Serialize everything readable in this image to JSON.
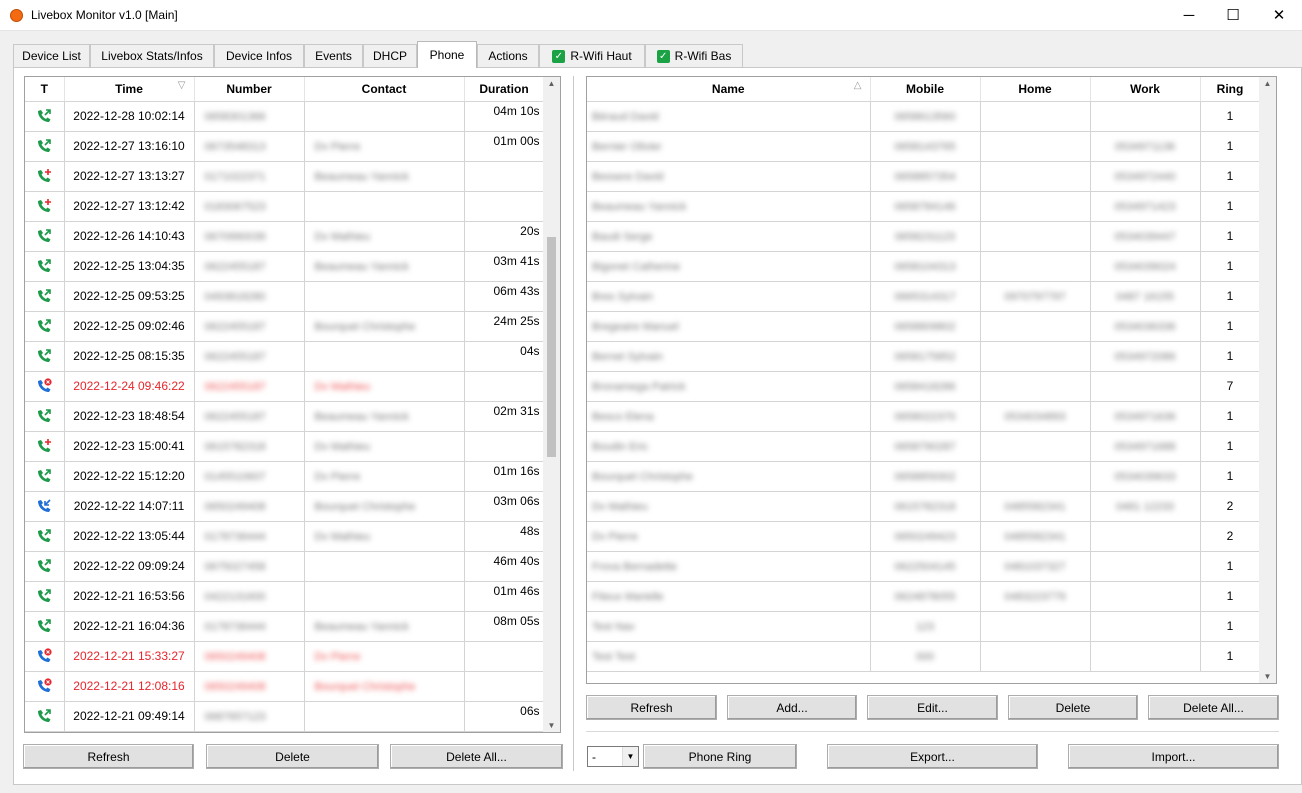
{
  "window": {
    "title": "Livebox Monitor v1.0 [Main]",
    "minimize_glyph": "─",
    "maximize_glyph": "☐",
    "close_glyph": "✕"
  },
  "tabs": [
    {
      "label": "Device List"
    },
    {
      "label": "Livebox Stats/Infos"
    },
    {
      "label": "Device Infos"
    },
    {
      "label": "Events"
    },
    {
      "label": "DHCP"
    },
    {
      "label": "Phone",
      "active": true
    },
    {
      "label": "Actions"
    },
    {
      "label": "R-Wifi Haut",
      "checked": true
    },
    {
      "label": "R-Wifi Bas",
      "checked": true
    }
  ],
  "calls": {
    "headers": {
      "type": "T",
      "time": "Time",
      "number": "Number",
      "contact": "Contact",
      "duration": "Duration"
    },
    "rows": [
      {
        "type": "outgoing",
        "time": "2022-12-28 10:02:14",
        "number": "0658301366",
        "contact": "",
        "duration": "04m 10s"
      },
      {
        "type": "outgoing",
        "time": "2022-12-27 13:16:10",
        "number": "0673548313",
        "contact": "Dv Pierre",
        "duration": "01m 00s"
      },
      {
        "type": "failed",
        "time": "2022-12-27 13:13:27",
        "number": "0171022371",
        "contact": "Beaumeau Yannick",
        "duration": ""
      },
      {
        "type": "failed",
        "time": "2022-12-27 13:12:42",
        "number": "0183067523",
        "contact": "",
        "duration": ""
      },
      {
        "type": "outgoing",
        "time": "2022-12-26 14:10:43",
        "number": "0670990039",
        "contact": "Dv Mathieu",
        "duration": "20s"
      },
      {
        "type": "outgoing",
        "time": "2022-12-25 13:04:35",
        "number": "0622455187",
        "contact": "Beaumeau Yannick",
        "duration": "03m 41s"
      },
      {
        "type": "outgoing",
        "time": "2022-12-25 09:53:25",
        "number": "0493818280",
        "contact": "",
        "duration": "06m 43s"
      },
      {
        "type": "outgoing",
        "time": "2022-12-25 09:02:46",
        "number": "0622455187",
        "contact": "Bourquet Christophe",
        "duration": "24m 25s"
      },
      {
        "type": "outgoing",
        "time": "2022-12-25 08:15:35",
        "number": "0622455187",
        "contact": "",
        "duration": "04s"
      },
      {
        "type": "missed",
        "time": "2022-12-24 09:46:22",
        "number": "0622455187",
        "contact": "Dv Mathieu",
        "duration": ""
      },
      {
        "type": "outgoing",
        "time": "2022-12-23 18:48:54",
        "number": "0622455187",
        "contact": "Beaumeau Yannick",
        "duration": "02m 31s"
      },
      {
        "type": "failed",
        "time": "2022-12-23 15:00:41",
        "number": "0615782318",
        "contact": "Dv Mathieu",
        "duration": ""
      },
      {
        "type": "outgoing",
        "time": "2022-12-22 15:12:20",
        "number": "0145510607",
        "contact": "Dv Pierre",
        "duration": "01m 16s"
      },
      {
        "type": "incoming",
        "time": "2022-12-22 14:07:11",
        "number": "0650249408",
        "contact": "Bourquet Christophe",
        "duration": "03m 06s"
      },
      {
        "type": "outgoing",
        "time": "2022-12-22 13:05:44",
        "number": "0178736444",
        "contact": "Dv Mathieu",
        "duration": "48s"
      },
      {
        "type": "outgoing",
        "time": "2022-12-22 09:09:24",
        "number": "0675027458",
        "contact": "",
        "duration": "46m 40s"
      },
      {
        "type": "outgoing",
        "time": "2022-12-21 16:53:56",
        "number": "0422131600",
        "contact": "",
        "duration": "01m 46s"
      },
      {
        "type": "outgoing",
        "time": "2022-12-21 16:04:36",
        "number": "0178736444",
        "contact": "Beaumeau Yannick",
        "duration": "08m 05s"
      },
      {
        "type": "missed",
        "time": "2022-12-21 15:33:27",
        "number": "0650249408",
        "contact": "Dv Pierre",
        "duration": ""
      },
      {
        "type": "missed",
        "time": "2022-12-21 12:08:16",
        "number": "0650249408",
        "contact": "Bourquet Christophe",
        "duration": ""
      },
      {
        "type": "outgoing",
        "time": "2022-12-21 09:49:14",
        "number": "0687657123",
        "contact": "",
        "duration": "06s"
      }
    ],
    "buttons": {
      "refresh": "Refresh",
      "delete": "Delete",
      "delete_all": "Delete All..."
    }
  },
  "contacts": {
    "headers": {
      "name": "Name",
      "mobile": "Mobile",
      "home": "Home",
      "work": "Work",
      "ring": "Ring"
    },
    "rows": [
      {
        "name": "Béraud David",
        "mobile": "0658613560",
        "home": "",
        "work": "",
        "ring": "1"
      },
      {
        "name": "Bernier Olivier",
        "mobile": "0658143765",
        "home": "",
        "work": "0534971136",
        "ring": "1"
      },
      {
        "name": "Bessere David",
        "mobile": "0658857354",
        "home": "",
        "work": "0534972440",
        "ring": "1"
      },
      {
        "name": "Beaumeau Yannick",
        "mobile": "0658784146",
        "home": "",
        "work": "0534971423",
        "ring": "1"
      },
      {
        "name": "Baudi Serge",
        "mobile": "0658231123",
        "home": "",
        "work": "0534039447",
        "ring": "1"
      },
      {
        "name": "Bigonet Catherine",
        "mobile": "0658104313",
        "home": "",
        "work": "0534039024",
        "ring": "1"
      },
      {
        "name": "Bres Sylvain",
        "mobile": "0665314317",
        "home": "0970797797",
        "work": "0487 16155",
        "ring": "1"
      },
      {
        "name": "Bregeaire Manuel",
        "mobile": "0658809802",
        "home": "",
        "work": "0534036336",
        "ring": "1"
      },
      {
        "name": "Bernet Sylvain",
        "mobile": "0658175852",
        "home": "",
        "work": "0534972086",
        "ring": "1"
      },
      {
        "name": "Bronamega Patrick",
        "mobile": "0658418286",
        "home": "",
        "work": "",
        "ring": "7"
      },
      {
        "name": "Besco Elena",
        "mobile": "0658022370",
        "home": "0534034893",
        "work": "0534971636",
        "ring": "1"
      },
      {
        "name": "Boudin Eric",
        "mobile": "0658790287",
        "home": "",
        "work": "0534971688",
        "ring": "1"
      },
      {
        "name": "Bourquet Christophe",
        "mobile": "0658859302",
        "home": "",
        "work": "0534039633",
        "ring": "1"
      },
      {
        "name": "Dv Mathieu",
        "mobile": "0615782318",
        "home": "0485582341",
        "work": "0481 12233",
        "ring": "2"
      },
      {
        "name": "Dv Pierre",
        "mobile": "0650249423",
        "home": "0485582341",
        "work": "",
        "ring": "2"
      },
      {
        "name": "Frova Bernadette",
        "mobile": "0622504145",
        "home": "0481037327",
        "work": "",
        "ring": "1"
      },
      {
        "name": "Fiteux Marielle",
        "mobile": "0624878055",
        "home": "0483223779",
        "work": "",
        "ring": "1"
      },
      {
        "name": "Test Nav",
        "mobile": "123",
        "home": "",
        "work": "",
        "ring": "1"
      },
      {
        "name": "Test Test",
        "mobile": "000",
        "home": "",
        "work": "",
        "ring": "1"
      }
    ],
    "buttons": {
      "refresh": "Refresh",
      "add": "Add...",
      "edit": "Edit...",
      "delete": "Delete",
      "delete_all": "Delete All..."
    }
  },
  "bottom": {
    "ring_select_value": "-",
    "phone_ring": "Phone Ring",
    "export": "Export...",
    "import": "Import..."
  },
  "colors": {
    "accent_green": "#1e9a4b",
    "missed_red": "#e8252b",
    "incoming_blue": "#1e6fd6",
    "app_icon": "#f46a12"
  }
}
